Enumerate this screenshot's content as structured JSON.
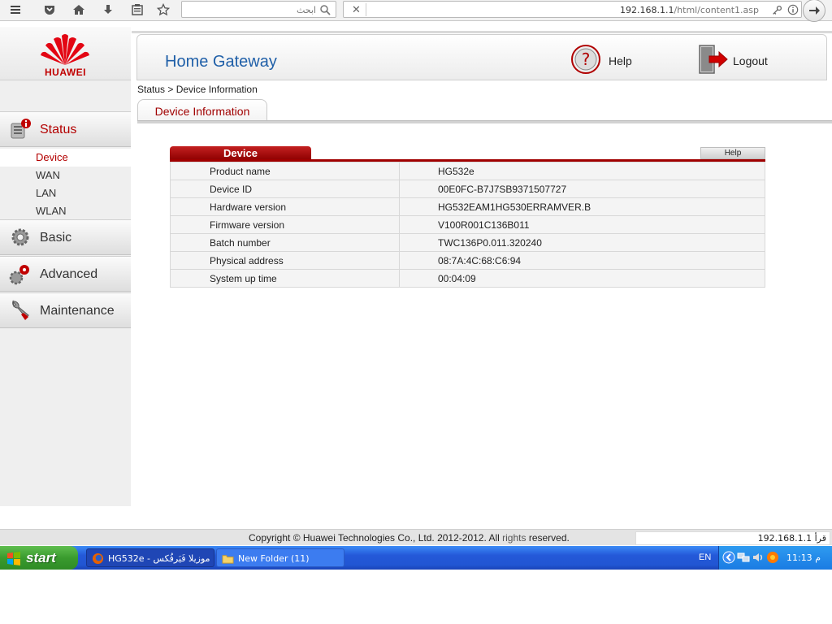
{
  "browser": {
    "search_placeholder": "ابحث",
    "url_host": "192.168.1.1",
    "url_path": "/html/content1.asp",
    "close_glyph": "✕"
  },
  "sidebar": {
    "logo_text": "HUAWEI",
    "menu": [
      {
        "label": "Status",
        "icon": "status-icon",
        "active": true
      },
      {
        "label": "Basic",
        "icon": "gear-icon"
      },
      {
        "label": "Advanced",
        "icon": "advanced-icon"
      },
      {
        "label": "Maintenance",
        "icon": "wrench-icon"
      }
    ],
    "status_sub": [
      {
        "label": "Device",
        "active": true
      },
      {
        "label": "WAN"
      },
      {
        "label": "LAN"
      },
      {
        "label": "WLAN"
      }
    ]
  },
  "header": {
    "title": "Home Gateway",
    "help_label": "Help",
    "logout_label": "Logout"
  },
  "breadcrumb": "Status > Device Information",
  "tab_label": "Device Information",
  "panel": {
    "title": "Device",
    "help_label": "Help",
    "rows": [
      {
        "key": "Product name",
        "value": "HG532e"
      },
      {
        "key": "Device ID",
        "value": "00E0FC-B7J7SB9371507727"
      },
      {
        "key": "Hardware version",
        "value": "HG532EAM1HG530ERRAMVER.B"
      },
      {
        "key": "Firmware version",
        "value": "V100R001C136B011"
      },
      {
        "key": "Batch number",
        "value": "TWC136P0.011.320240"
      },
      {
        "key": "Physical address",
        "value": "08:7A:4C:68:C6:94"
      },
      {
        "key": "System up time",
        "value": "00:04:09"
      }
    ]
  },
  "footer": {
    "copyright_a": "Copyright © Huawei Technologies Co., Ltd. 2012-2012. All ",
    "copyright_b": "rights",
    "copyright_c": " reserved.",
    "status_right": "192.168.1.1 قرأ"
  },
  "taskbar": {
    "start_label": "start",
    "tasks": [
      {
        "label": "HG532e - موزيلا فَيَرفُكس",
        "icon": "firefox-icon"
      },
      {
        "label": "New Folder (11)",
        "icon": "folder-icon"
      }
    ],
    "lang": "EN",
    "clock": "11:13 م"
  },
  "colors": {
    "accent_red": "#a00000",
    "title_blue": "#1f5fa8",
    "taskbar_blue": "#2458d8",
    "start_green": "#3a9b2e"
  }
}
